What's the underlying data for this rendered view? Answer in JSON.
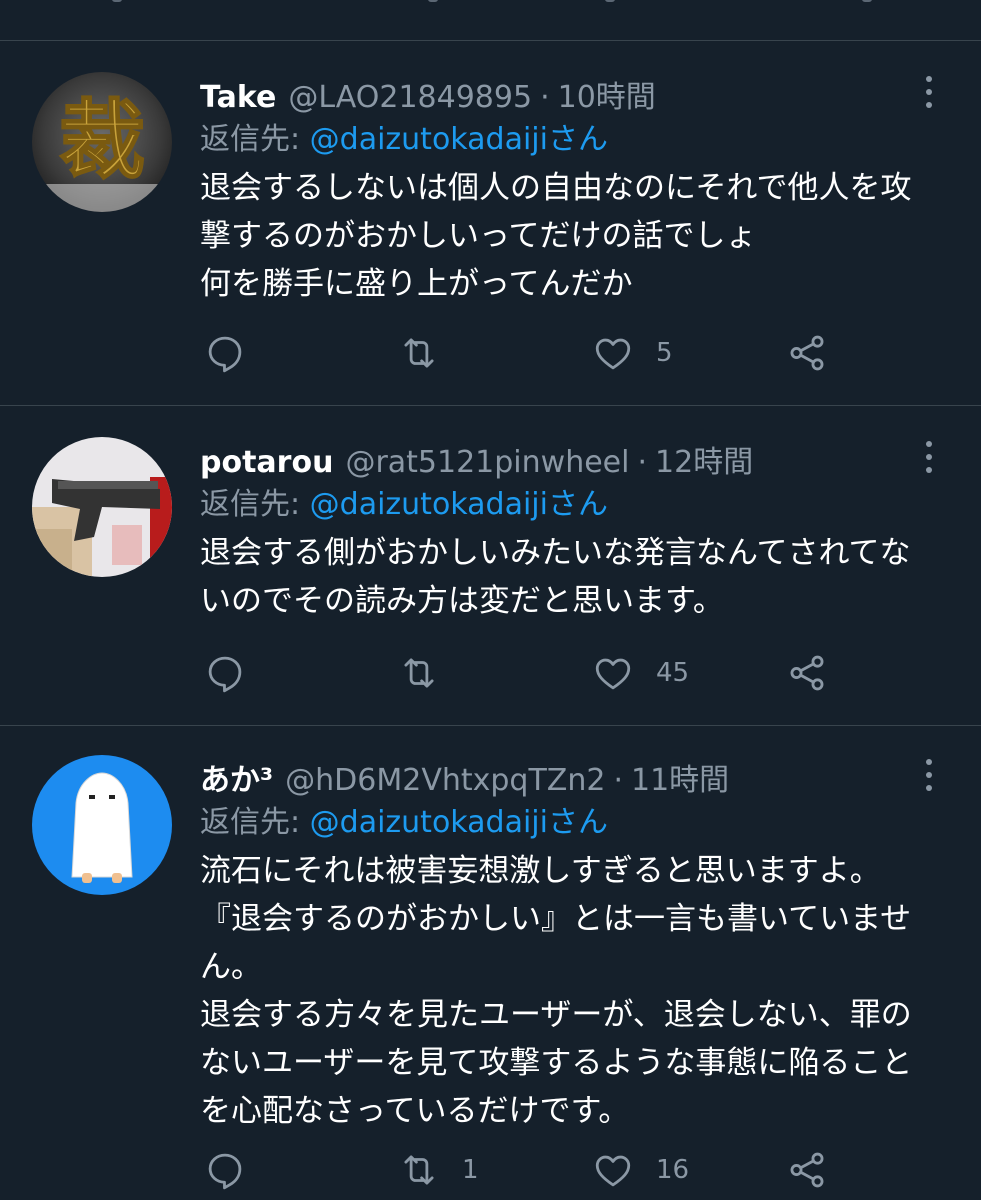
{
  "tweets": [
    {
      "name": "Take",
      "handle": "@LAO21849895",
      "separator": "·",
      "time": "10時間",
      "reply_prefix": "返信先: ",
      "reply_mention": "@daizutokadaiji",
      "reply_suffix": "さん",
      "lines": [
        "退会するしないは個人の自由なのにそれで他人を攻",
        "撃するのがおかしいってだけの話でしょ",
        "何を勝手に盛り上がってんだか"
      ],
      "avatar_glyph": "裁",
      "retweets": "",
      "likes": "5"
    },
    {
      "name": "potarou",
      "handle": "@rat5121pinwheel",
      "separator": "·",
      "time": "12時間",
      "reply_prefix": "返信先: ",
      "reply_mention": "@daizutokadaiji",
      "reply_suffix": "さん",
      "lines": [
        "退会する側がおかしいみたいな発言なんてされてな",
        "いのでその読み方は変だと思います。"
      ],
      "retweets": "",
      "likes": "45"
    },
    {
      "name": "あか³",
      "handle": "@hD6M2VhtxpqTZn2",
      "separator": "·",
      "time": "11時間",
      "reply_prefix": "返信先: ",
      "reply_mention": "@daizutokadaiji",
      "reply_suffix": "さん",
      "lines": [
        "流石にそれは被害妄想激しすぎると思いますよ。",
        "『退会するのがおかしい』とは一言も書いていませ",
        "ん。",
        "退会する方々を見たユーザーが、退会しない、罪の",
        "ないユーザーを見て攻撃するような事態に陥ること",
        "を心配なさっているだけです。"
      ],
      "retweets": "1",
      "likes": "16"
    }
  ],
  "colors": {
    "background": "#15202b",
    "divider": "#38444d",
    "secondary_text": "#8b98a5",
    "link": "#1d9bf0"
  },
  "icons": [
    "reply-icon",
    "retweet-icon",
    "like-icon",
    "share-icon",
    "more-icon"
  ]
}
